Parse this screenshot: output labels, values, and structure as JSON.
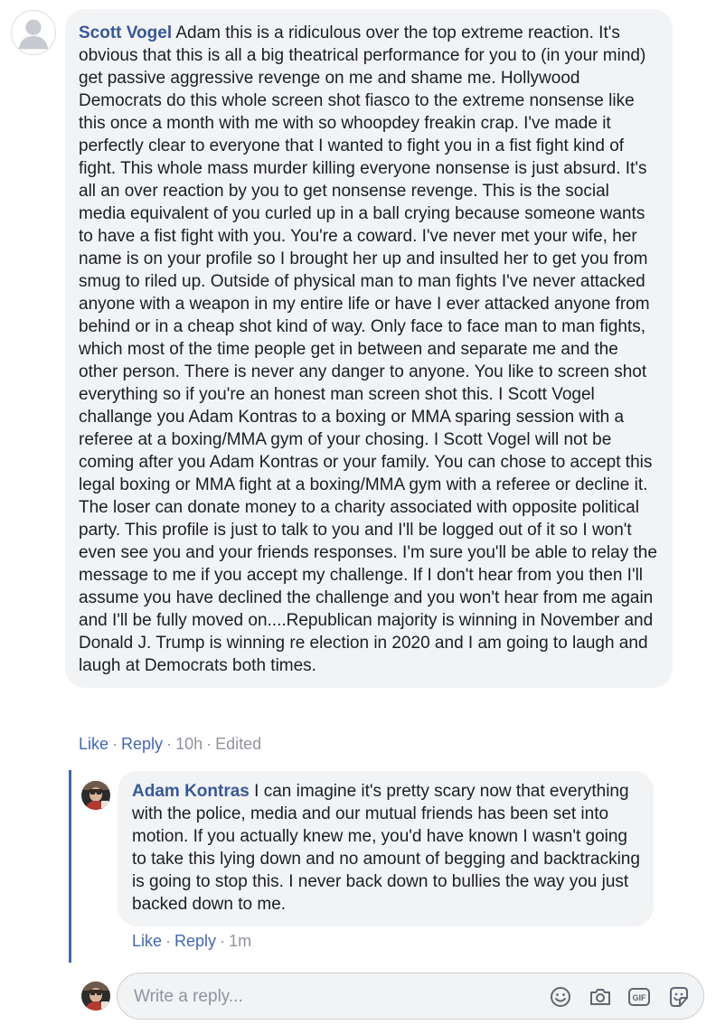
{
  "comment": {
    "author": "Scott Vogel",
    "text": "Adam this is a ridiculous over the top extreme reaction. It's obvious that this is all a big theatrical performance for you to (in your mind) get passive aggressive revenge on me and shame me. Hollywood Democrats do this whole screen shot fiasco to the extreme nonsense like this once a month with me with so whoopdey freakin crap. I've made it perfectly clear to everyone that I wanted to fight you in a fist fight kind of fight. This whole mass murder killing everyone nonsense is just absurd. It's all an over reaction by you to get nonsense revenge. This is the social media equivalent of you curled up in a ball crying because someone wants to have a fist fight with you. You're a coward. I've never met your wife, her name is on your profile so I brought her up and insulted her to get you from smug to riled up. Outside of physical man to man fights I've never attacked anyone with a weapon in my entire life or have I ever attacked anyone from behind or in a cheap shot kind of way. Only face to face man to man fights, which most of the time people get in between and separate me and the other person. There is never any danger to anyone. You like to screen shot everything so if you're an honest man screen shot this. I Scott Vogel challange you Adam Kontras to a boxing or MMA sparing session with a referee at a boxing/MMA gym of your chosing. I Scott Vogel will not be coming after you Adam Kontras or your family. You can chose to accept this legal boxing or MMA fight at a boxing/MMA gym with a referee or decline it. The loser can donate money to a charity associated with opposite political party. This profile is just to talk to you and I'll be logged out of it so I won't even see you and your friends responses. I'm sure you'll be able to relay the message to me if you accept my challenge. If I don't hear from you then I'll assume you have declined the challenge and you won't hear from me again and I'll be fully moved on....Republican majority is winning in November and Donald J. Trump is winning re election in 2020 and I am going to laugh and laugh at Democrats both times.",
    "actions": {
      "like": "Like",
      "reply": "Reply",
      "time": "10h",
      "edited": "Edited",
      "sep": "·"
    }
  },
  "reply": {
    "author": "Adam Kontras",
    "text": "I can imagine it's pretty scary now that everything with the police, media and our mutual friends has been set into motion. If you actually knew me, you'd have known I wasn't going to take this lying down and no amount of begging and backtracking is going to stop this. I never back down to bullies the way you just backed down to me.",
    "actions": {
      "like": "Like",
      "reply": "Reply",
      "time": "1m",
      "sep": "·"
    }
  },
  "compose": {
    "placeholder": "Write a reply...",
    "icons": [
      "emoji-icon",
      "camera-icon",
      "gif-icon",
      "sticker-icon"
    ]
  },
  "colors": {
    "author": "#385898",
    "link": "#4267b2",
    "meta": "#90949c",
    "bubble": "#f2f3f5",
    "thread_line": "#4267b2"
  }
}
